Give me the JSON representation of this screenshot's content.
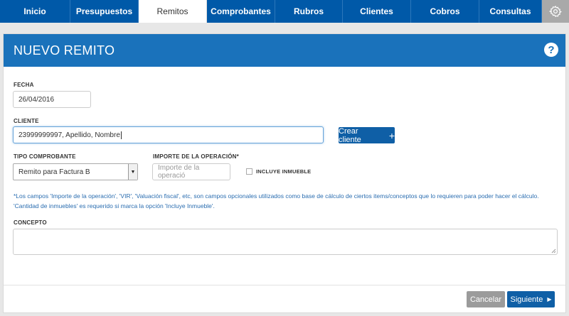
{
  "nav": {
    "tabs": [
      {
        "label": "Inicio",
        "active": false
      },
      {
        "label": "Presupuestos",
        "active": false
      },
      {
        "label": "Remitos",
        "active": true
      },
      {
        "label": "Comprobantes",
        "active": false
      },
      {
        "label": "Rubros",
        "active": false
      },
      {
        "label": "Clientes",
        "active": false
      },
      {
        "label": "Cobros",
        "active": false
      },
      {
        "label": "Consultas",
        "active": false
      }
    ],
    "settings_icon": "gear-icon"
  },
  "panel": {
    "title": "NUEVO REMITO",
    "help_label": "?"
  },
  "form": {
    "fecha_label": "FECHA",
    "fecha_value": "26/04/2016",
    "cliente_label": "CLIENTE",
    "cliente_value": "23999999997, Apellido, Nombre",
    "crear_cliente_label": "Crear cliente",
    "tipo_label": "TIPO COMPROBANTE",
    "tipo_value": "Remito para Factura B",
    "importe_label": "IMPORTE DE LA OPERACIÓN*",
    "importe_placeholder": "Importe de la operació",
    "inmueble_label": "INCLUYE INMUEBLE",
    "inmueble_checked": false,
    "note": "*Los campos 'Importe de la operación', 'VIR', 'Valuación fiscal', etc, son campos opcionales utilizados como base de cálculo de ciertos items/conceptos que lo requieren para poder hacer el cálculo. 'Cantidad de inmuebles' es requerido si marca la opción 'Incluye Inmueble'.",
    "concepto_label": "CONCEPTO",
    "concepto_value": ""
  },
  "footer": {
    "cancel_label": "Cancelar",
    "next_label": "Siguiente"
  },
  "colors": {
    "primary": "#0059a8",
    "header": "#1a72bb",
    "note": "#2a6db0"
  }
}
